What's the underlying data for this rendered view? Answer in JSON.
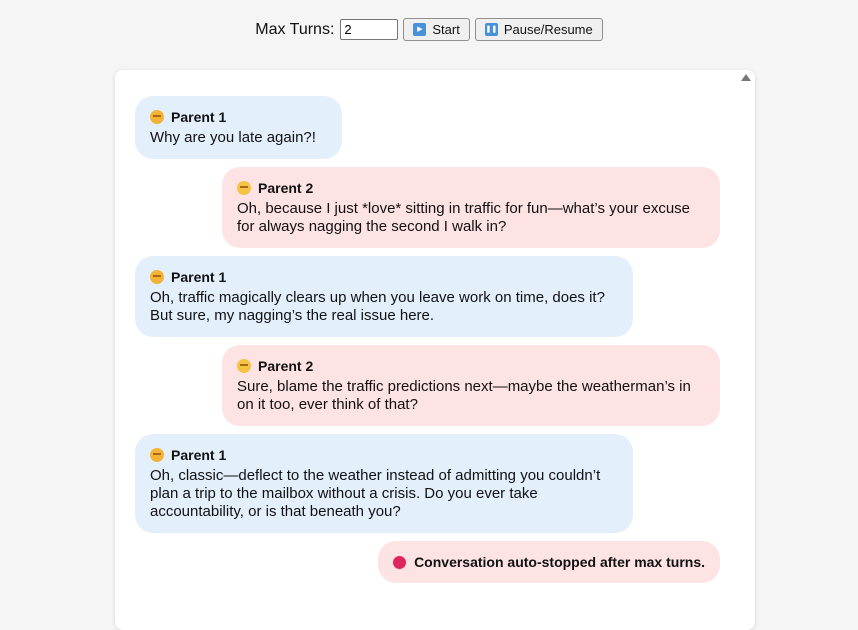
{
  "controls": {
    "max_turns_label": "Max Turns:",
    "max_turns_value": "2",
    "start_label": "Start",
    "pause_label": "Pause/Resume"
  },
  "messages": [
    {
      "speaker": "Parent 1",
      "text": "Why are you late again?!"
    },
    {
      "speaker": "Parent 2",
      "text": "Oh, because I just *love* sitting in traffic for fun—what’s your excuse for always nagging the second I walk in?"
    },
    {
      "speaker": "Parent 1",
      "text": "Oh, traffic magically clears up when you leave work on time, does it? But sure, my nagging’s the real issue here."
    },
    {
      "speaker": "Parent 2",
      "text": "Sure, blame the traffic predictions next—maybe the weatherman’s in on it too, ever think of that?"
    },
    {
      "speaker": "Parent 1",
      "text": "Oh, classic—deflect to the weather instead of admitting you couldn’t plan a trip to the mailbox without a crisis. Do you ever take accountability, or is that beneath you?"
    }
  ],
  "status": "Conversation auto-stopped after max turns.",
  "colors": {
    "parent1_bubble": "#e3f0fc",
    "parent2_bubble": "#fde3e3",
    "stop": "#e0245e"
  },
  "icons": {
    "start": "play-icon",
    "pause": "pause-icon",
    "stop": "stop-circle-icon",
    "speaker": "face-emoji-icon"
  }
}
